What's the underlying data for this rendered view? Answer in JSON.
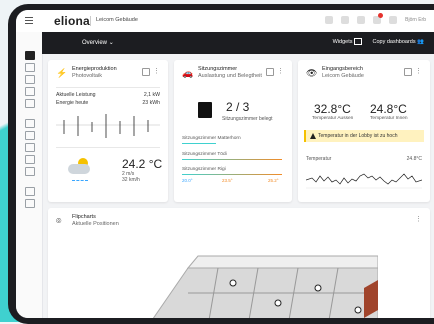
{
  "app": {
    "logo": "eliona",
    "building": "Leicom Gebäude"
  },
  "topbar": {
    "user": "Björn Erb"
  },
  "nav": {
    "view": "Overview",
    "widgets_label": "Widgets",
    "copy_label": "Copy dashboards"
  },
  "cards": {
    "pv": {
      "title": "Energieproduktion",
      "subtitle": "Photovoltaik",
      "rows": [
        {
          "label": "Aktuelle Leistung",
          "value": "2,1 kW"
        },
        {
          "label": "Energie heute",
          "value": "23 kWh"
        }
      ],
      "temp": "24.2 °C",
      "wind1": "2 m/s",
      "wind2": "32 km/h"
    },
    "rooms": {
      "title": "Sitzungszimmer",
      "subtitle": "Auslastung und Belegtheit",
      "count": "2 / 3",
      "count_label": "Sitzungszimmer belegt",
      "rooms": [
        "Sitzungszimmer Matterhorn",
        "Sitzungszimmer Tödi",
        "Sitzungszimmer Rigi"
      ],
      "scale_min": "20.0°",
      "scale_mid": "23.5°",
      "scale_max": "25.2°"
    },
    "entrance": {
      "title": "Eingangsbereich",
      "subtitle": "Leicom Gebäude",
      "temp_out": "32.8°C",
      "temp_out_label": "Temperatur Aussen",
      "temp_in": "24.8°C",
      "temp_in_label": "Temperatur Innen",
      "warning": "Temperatur in der Lobby ist zu hoch",
      "chart_label": "Temperatur",
      "chart_value": "24.8°C"
    },
    "floor": {
      "title": "Flipcharts",
      "subtitle": "Aktuelle Positionen"
    }
  }
}
